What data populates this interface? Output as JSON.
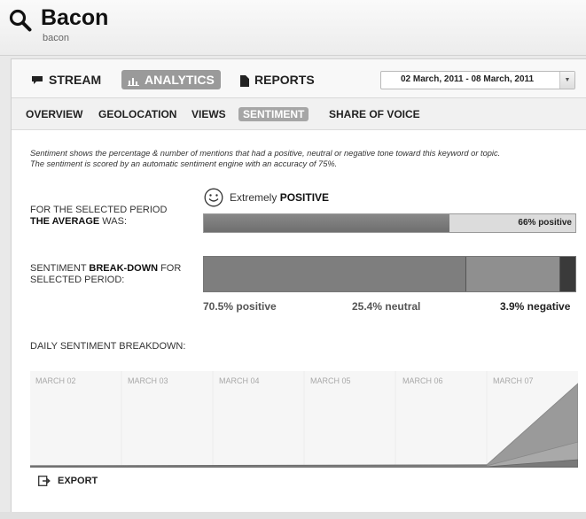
{
  "header": {
    "title": "Bacon",
    "subtitle": "bacon",
    "icon": "search-icon"
  },
  "tabs": [
    {
      "label": "STREAM",
      "icon": "comment-icon",
      "active": false
    },
    {
      "label": "ANALYTICS",
      "icon": "bar-chart-icon",
      "active": true
    },
    {
      "label": "REPORTS",
      "icon": "document-icon",
      "active": false
    }
  ],
  "date_range": {
    "value": "02 March, 2011 - 08 March, 2011"
  },
  "subnav": [
    {
      "label": "OVERVIEW",
      "active": false
    },
    {
      "label": "GEOLOCATION",
      "active": false
    },
    {
      "label": "VIEWS",
      "active": false
    },
    {
      "label": "SENTIMENT",
      "active": true
    },
    {
      "label": "SHARE OF VOICE",
      "active": false
    }
  ],
  "description": {
    "line1": "Sentiment shows the percentage & number of mentions that had a positive, neutral or negative tone toward this keyword or topic.",
    "line2": "The sentiment is scored by an automatic sentiment engine with an accuracy of 75%."
  },
  "average": {
    "label_line1": "FOR THE SELECTED PERIOD",
    "label_bold": "THE AVERAGE",
    "label_rest": " WAS:",
    "mood_prefix": "Extremely",
    "mood_value": "POSITIVE",
    "icon": "smile-icon",
    "bar_label": "66% positive",
    "fraction": 0.66
  },
  "breakdown": {
    "label_prefix": "SENTIMENT ",
    "label_bold": "BREAK-DOWN",
    "label_suffix": " FOR",
    "label_line2": "SELECTED PERIOD:",
    "positive_label": "70.5% positive",
    "neutral_label": "25.4% neutral",
    "negative_label": "3.9% negative",
    "positive": 0.705,
    "neutral": 0.254,
    "negative": 0.039,
    "colors": {
      "positive": "#7e7e7e",
      "neutral": "#8f8f8f",
      "negative": "#3a3a3a"
    }
  },
  "daily": {
    "title": "DAILY SENTIMENT BREAKDOWN:",
    "days": [
      "MARCH 02",
      "MARCH 03",
      "MARCH 04",
      "MARCH 05",
      "MARCH 06",
      "MARCH 07"
    ]
  },
  "export": {
    "label": "EXPORT",
    "icon": "export-icon"
  }
}
